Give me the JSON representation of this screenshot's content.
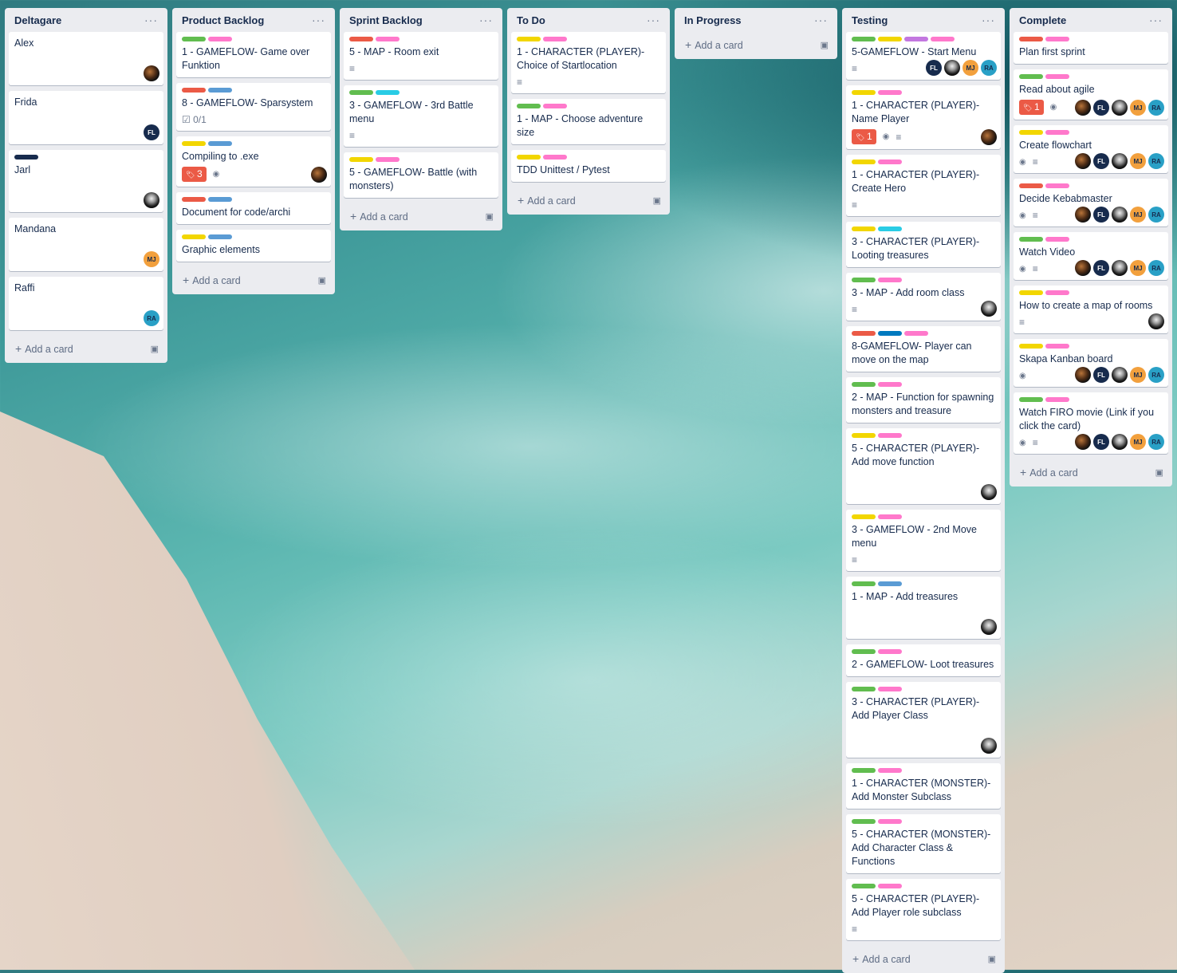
{
  "colors": {
    "green": "#61bd4f",
    "pink": "#ff78cb",
    "red": "#eb5a46",
    "blue": "#5a9bd4",
    "yellow": "#f2d600",
    "purple": "#c377e0",
    "sky": "#29cce5",
    "navy": "#172b4d",
    "darkblue": "#0079bf"
  },
  "columns": [
    {
      "title": "Deltagare",
      "menu": "···",
      "add_label": "Add a card",
      "cards": [
        {
          "title": "Alex",
          "labels": [],
          "members": [
            "photo-a"
          ]
        },
        {
          "title": "Frida",
          "labels": [],
          "members": [
            "FL"
          ]
        },
        {
          "title": "Jarl",
          "labels": [
            "navy"
          ],
          "members": [
            "photo-j"
          ]
        },
        {
          "title": "Mandana",
          "labels": [],
          "members": [
            "MJ"
          ]
        },
        {
          "title": "Raffi",
          "labels": [],
          "members": [
            "RA"
          ]
        }
      ]
    },
    {
      "title": "Product Backlog",
      "menu": "···",
      "add_label": "Add a card",
      "cards": [
        {
          "title": "1 - GAMEFLOW- Game over Funktion",
          "labels": [
            "green",
            "pink"
          ]
        },
        {
          "title": "8 - GAMEFLOW- Sparsystem",
          "labels": [
            "red",
            "blue"
          ],
          "checklist": "0/1"
        },
        {
          "title": "Compiling to .exe",
          "labels": [
            "yellow",
            "blue"
          ],
          "comments": "3",
          "watch": true,
          "members": [
            "photo-a"
          ]
        },
        {
          "title": "Document for code/archi",
          "labels": [
            "red",
            "blue"
          ]
        },
        {
          "title": "Graphic elements",
          "labels": [
            "yellow",
            "blue"
          ]
        }
      ]
    },
    {
      "title": "Sprint Backlog",
      "menu": "···",
      "add_label": "Add a card",
      "cards": [
        {
          "title": "5 - MAP - Room exit",
          "labels": [
            "red",
            "pink"
          ],
          "desc": true
        },
        {
          "title": "3 - GAMEFLOW - 3rd Battle menu",
          "labels": [
            "green",
            "sky"
          ],
          "desc": true
        },
        {
          "title": "5 - GAMEFLOW- Battle (with monsters)",
          "labels": [
            "yellow",
            "pink"
          ]
        }
      ]
    },
    {
      "title": "To Do",
      "menu": "···",
      "add_label": "Add a card",
      "cards": [
        {
          "title": "1 - CHARACTER (PLAYER)- Choice of Startlocation",
          "labels": [
            "yellow",
            "pink"
          ],
          "desc": true
        },
        {
          "title": "1 - MAP - Choose adventure size",
          "labels": [
            "green",
            "pink"
          ]
        },
        {
          "title": "TDD Unittest / Pytest",
          "labels": [
            "yellow",
            "pink"
          ]
        }
      ]
    },
    {
      "title": "In Progress",
      "menu": "···",
      "add_label": "Add a card",
      "cards": []
    },
    {
      "title": "Testing",
      "menu": "···",
      "add_label": "Add a card",
      "cards": [
        {
          "title": "5-GAMEFLOW - Start Menu",
          "labels": [
            "green",
            "yellow",
            "purple",
            "pink"
          ],
          "desc": true,
          "members": [
            "FL",
            "photo-j",
            "MJ",
            "RA"
          ]
        },
        {
          "title": "1 - CHARACTER (PLAYER)- Name Player",
          "labels": [
            "yellow",
            "pink"
          ],
          "comments": "1",
          "watch": true,
          "desc": true,
          "members": [
            "photo-a"
          ]
        },
        {
          "title": "1 - CHARACTER (PLAYER)- Create Hero",
          "labels": [
            "yellow",
            "pink"
          ],
          "desc": true
        },
        {
          "title": "3 - CHARACTER (PLAYER)- Looting treasures",
          "labels": [
            "yellow",
            "sky"
          ]
        },
        {
          "title": "3 - MAP - Add room class",
          "labels": [
            "green",
            "pink"
          ],
          "desc": true,
          "members": [
            "photo-j"
          ]
        },
        {
          "title": "8-GAMEFLOW- Player can move on the map",
          "labels": [
            "red",
            "darkblue",
            "pink"
          ]
        },
        {
          "title": "2 - MAP - Function for spawning monsters and treasure",
          "labels": [
            "green",
            "pink"
          ]
        },
        {
          "title": "5 - CHARACTER (PLAYER)- Add move function",
          "labels": [
            "yellow",
            "pink"
          ],
          "members": [
            "photo-j"
          ]
        },
        {
          "title": "3 - GAMEFLOW - 2nd Move menu",
          "labels": [
            "yellow",
            "pink"
          ],
          "desc": true
        },
        {
          "title": "1 - MAP - Add treasures",
          "labels": [
            "green",
            "blue"
          ],
          "members": [
            "photo-j"
          ]
        },
        {
          "title": "2 - GAMEFLOW- Loot treasures",
          "labels": [
            "green",
            "pink"
          ]
        },
        {
          "title": "3 - CHARACTER (PLAYER)- Add Player Class",
          "labels": [
            "green",
            "pink"
          ],
          "members": [
            "photo-j"
          ]
        },
        {
          "title": "1 - CHARACTER (MONSTER)- Add Monster Subclass",
          "labels": [
            "green",
            "pink"
          ]
        },
        {
          "title": "5 - CHARACTER (MONSTER)- Add Character Class & Functions",
          "labels": [
            "green",
            "pink"
          ]
        },
        {
          "title": "5 - CHARACTER (PLAYER)- Add Player role subclass",
          "labels": [
            "green",
            "pink"
          ],
          "desc": true
        }
      ]
    },
    {
      "title": "Complete",
      "menu": "···",
      "add_label": "Add a card",
      "cards": [
        {
          "title": "Plan first sprint",
          "labels": [
            "red",
            "pink"
          ]
        },
        {
          "title": "Read about agile",
          "labels": [
            "green",
            "pink"
          ],
          "comments": "1",
          "watch": true,
          "members": [
            "photo-a",
            "FL",
            "photo-j",
            "MJ",
            "RA"
          ]
        },
        {
          "title": "Create flowchart",
          "labels": [
            "yellow",
            "pink"
          ],
          "watch": true,
          "desc": true,
          "members": [
            "photo-a",
            "FL",
            "photo-j",
            "MJ",
            "RA"
          ]
        },
        {
          "title": "Decide Kebabmaster",
          "labels": [
            "red",
            "pink"
          ],
          "watch": true,
          "desc": true,
          "members": [
            "photo-a",
            "FL",
            "photo-j",
            "MJ",
            "RA"
          ]
        },
        {
          "title": "Watch Video",
          "labels": [
            "green",
            "pink"
          ],
          "watch": true,
          "desc": true,
          "members": [
            "photo-a",
            "FL",
            "photo-j",
            "MJ",
            "RA"
          ]
        },
        {
          "title": "How to create a map of rooms",
          "labels": [
            "yellow",
            "pink"
          ],
          "desc": true,
          "members": [
            "photo-j"
          ]
        },
        {
          "title": "Skapa Kanban board",
          "labels": [
            "yellow",
            "pink"
          ],
          "watch": true,
          "members": [
            "photo-a",
            "FL",
            "photo-j",
            "MJ",
            "RA"
          ]
        },
        {
          "title": "Watch FIRO movie (Link if you click the card)",
          "labels": [
            "green",
            "pink"
          ],
          "watch": true,
          "desc": true,
          "members": [
            "photo-a",
            "FL",
            "photo-j",
            "MJ",
            "RA"
          ]
        }
      ]
    }
  ]
}
